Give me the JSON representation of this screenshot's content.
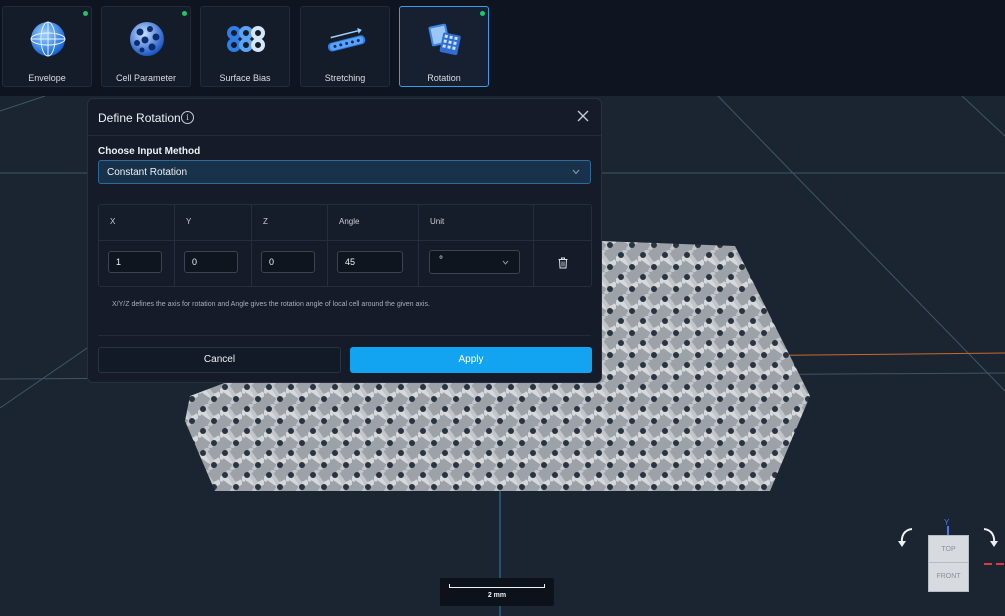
{
  "toolbar": {
    "tools": [
      {
        "label": "Envelope",
        "icon": "globe-icon",
        "indicator": true,
        "active": false
      },
      {
        "label": "Cell Parameter",
        "icon": "cell-sphere-icon",
        "indicator": true,
        "active": false
      },
      {
        "label": "Surface Bias",
        "icon": "surface-bias-icon",
        "indicator": false,
        "active": false
      },
      {
        "label": "Stretching",
        "icon": "stretching-icon",
        "indicator": false,
        "active": false
      },
      {
        "label": "Rotation",
        "icon": "rotation-cubes-icon",
        "indicator": true,
        "active": true
      }
    ],
    "indicator_color": "#22c36a"
  },
  "dialog": {
    "title": "Define Rotation",
    "info_icon": "info-icon",
    "close_icon": "close-icon",
    "input_method_label": "Choose Input Method",
    "input_method_value": "Constant Rotation",
    "table": {
      "headers": [
        "X",
        "Y",
        "Z",
        "Angle",
        "Unit"
      ],
      "rows": [
        {
          "x": "1",
          "y": "0",
          "z": "0",
          "angle": "45",
          "unit": "°"
        }
      ]
    },
    "help_text": "X/Y/Z defines the axis for rotation and Angle gives the rotation angle of local cell around the given axis.",
    "cancel_label": "Cancel",
    "apply_label": "Apply",
    "apply_color": "#13a4f1"
  },
  "viewport": {
    "scale_label": "2 mm",
    "view_cube": {
      "top": "TOP",
      "front": "FRONT",
      "axis_y": "Y"
    },
    "background": "#1a2531"
  }
}
